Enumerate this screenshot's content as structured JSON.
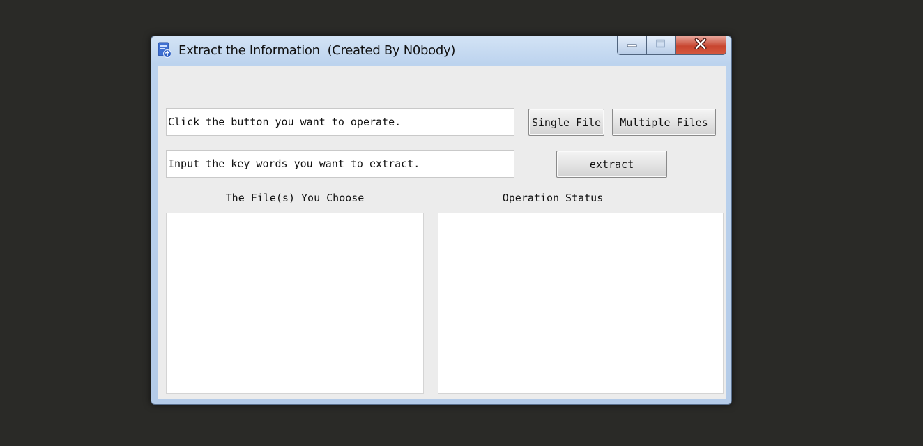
{
  "window": {
    "title": "Extract the Information  (Created By N0body)",
    "icon": "app-document-upload-icon"
  },
  "title_controls": {
    "minimize": "minimize-icon",
    "maximize": "maximize-icon",
    "close": "close-icon"
  },
  "main": {
    "operation_field": {
      "value": "Click the button you want to operate."
    },
    "keywords_field": {
      "value": "Input the key words you want to extract."
    },
    "single_file_label": "Single File",
    "multiple_files_label": "Multiple Files",
    "extract_label": "extract",
    "files_heading": "The File(s) You Choose",
    "status_heading": "Operation Status"
  },
  "colors": {
    "titlebar": "#bcd3ee",
    "close_button": "#c8452f",
    "client_background": "#ececec",
    "desktop": "#2a2a27"
  }
}
